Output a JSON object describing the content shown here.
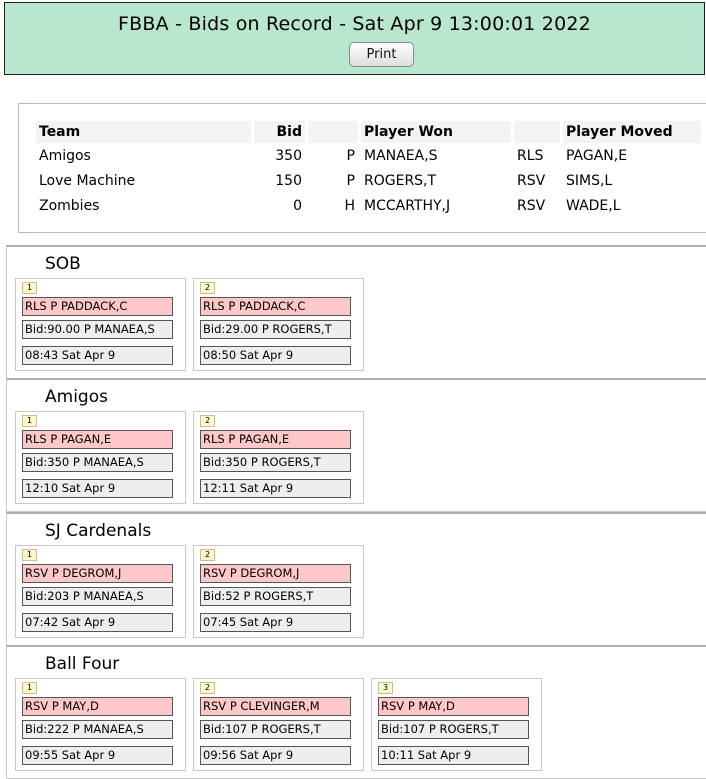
{
  "header": {
    "title": "FBBA - Bids on Record - Sat Apr 9 13:00:01 2022",
    "print_label": "Print"
  },
  "summary": {
    "headers": {
      "team": "Team",
      "bid": "Bid",
      "player_won": "Player Won",
      "player_moved": "Player Moved"
    },
    "rows": [
      {
        "team": "Amigos",
        "bid": "350",
        "pos": "P",
        "won": "MANAEA,S",
        "move": "RLS",
        "moved": "PAGAN,E"
      },
      {
        "team": "Love Machine",
        "bid": "150",
        "pos": "P",
        "won": "ROGERS,T",
        "move": "RSV",
        "moved": "SIMS,L"
      },
      {
        "team": "Zombies",
        "bid": "0",
        "pos": "H",
        "won": "MCCARTHY,J",
        "move": "RSV",
        "moved": "WADE,L"
      }
    ]
  },
  "teams": [
    {
      "name": "SOB",
      "cards": [
        {
          "num": "1",
          "move": "RLS P PADDACK,C",
          "bid": "Bid:90.00 P MANAEA,S",
          "time": "08:43 Sat Apr 9"
        },
        {
          "num": "2",
          "move": "RLS P PADDACK,C",
          "bid": "Bid:29.00 P ROGERS,T",
          "time": "08:50 Sat Apr 9"
        }
      ]
    },
    {
      "name": "Amigos",
      "cards": [
        {
          "num": "1",
          "move": "RLS P PAGAN,E",
          "bid": "Bid:350 P MANAEA,S",
          "time": "12:10 Sat Apr 9"
        },
        {
          "num": "2",
          "move": "RLS P PAGAN,E",
          "bid": "Bid:350 P ROGERS,T",
          "time": "12:11 Sat Apr 9"
        }
      ]
    },
    {
      "name": "SJ Cardenals",
      "cards": [
        {
          "num": "1",
          "move": "RSV P DEGROM,J",
          "bid": "Bid:203 P MANAEA,S",
          "time": "07:42 Sat Apr 9"
        },
        {
          "num": "2",
          "move": "RSV P DEGROM,J",
          "bid": "Bid:52 P ROGERS,T",
          "time": "07:45 Sat Apr 9"
        }
      ]
    },
    {
      "name": "Ball Four",
      "cards": [
        {
          "num": "1",
          "move": "RSV P MAY,D",
          "bid": "Bid:222 P MANAEA,S",
          "time": "09:55 Sat Apr 9"
        },
        {
          "num": "2",
          "move": "RSV P CLEVINGER,M",
          "bid": "Bid:107 P ROGERS,T",
          "time": "09:56 Sat Apr 9"
        },
        {
          "num": "3",
          "move": "RSV P MAY,D",
          "bid": "Bid:107 P ROGERS,T",
          "time": "10:11 Sat Apr 9"
        }
      ]
    }
  ],
  "colors": {
    "header_bg": "#b8e6cf",
    "move_bar": "#ffc8c8",
    "info_bar": "#eeeeee",
    "number_badge": "#fff8cc"
  }
}
